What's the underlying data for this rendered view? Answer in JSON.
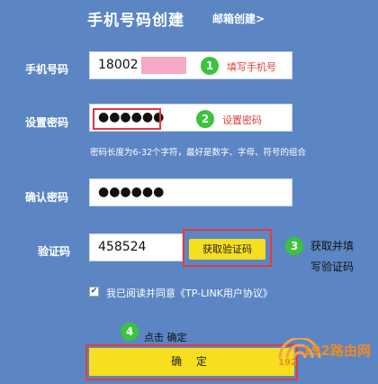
{
  "header": {
    "title": "手机号码创建",
    "alt_link": "邮箱创建>"
  },
  "form": {
    "phone_label": "手机号码",
    "phone_value": "18002",
    "password_label": "设置密码",
    "password_value": "●●●●●●",
    "password_hint": "密码长度为6-32个字符，最好是数字、字母、符号的组合",
    "confirm_label": "确认密码",
    "confirm_value": "●●●●●●",
    "code_label": "验证码",
    "code_value": "458524",
    "get_code_button": "获取验证码",
    "agree_prefix": "我已阅读并同意",
    "agree_link": "《TP-LINK用户协议》",
    "submit_button": "确 定"
  },
  "annotations": {
    "step1": "1",
    "step1_text": "填写手机号",
    "step2": "2",
    "step2_text": "设置密码",
    "step3": "3",
    "step3_line1": "获取并填",
    "step3_line2": "写验证码",
    "step4": "4",
    "step4_text": "点击 确定"
  },
  "watermark": {
    "brand": "192路由网",
    "num": "192"
  },
  "colors": {
    "background": "#5b86c3",
    "highlight": "#e53b3b",
    "button": "#f7de1f",
    "step": "#39c43b"
  }
}
